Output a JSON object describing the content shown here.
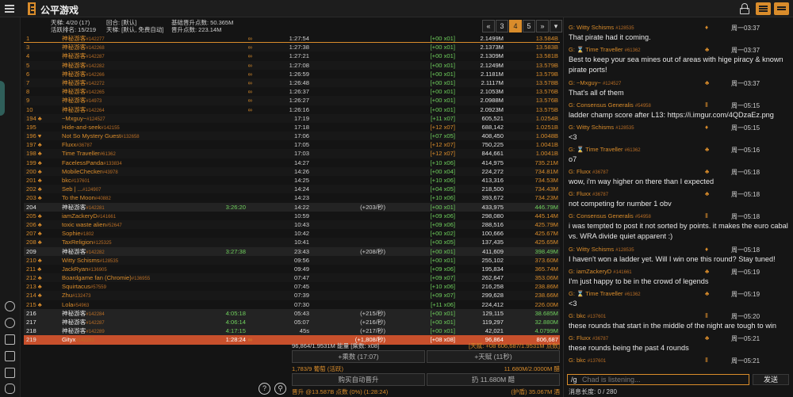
{
  "app": {
    "title": "公平游戏"
  },
  "stats": {
    "ladder": "天梯: 4/20 (17)",
    "active_rank": "活跃排名: 15/219",
    "round": "回合: [默认]",
    "ladder_type": "天梯: [默认, 免费自动]",
    "base_promote": "基础晋升点数: 50.365M",
    "promote_pts": "晋升点数: 223.14M"
  },
  "pager": {
    "first": "«",
    "pages": [
      "3",
      "4",
      "5"
    ],
    "active": "4",
    "last": "»",
    "dropdown": "▾"
  },
  "leaderboard": [
    {
      "rank": "1",
      "name": "神秘游客",
      "id": "#142277",
      "ex": "",
      "inf": "∞",
      "time": "1:27:54",
      "gain": "",
      "mult": "[+00 x01]",
      "pts": "2.1499M",
      "rate": "13.584B",
      "first": true
    },
    {
      "rank": "3",
      "name": "神秘游客",
      "id": "#142268",
      "ex": "",
      "inf": "∞",
      "time": "1:27:38",
      "gain": "",
      "mult": "[+00 x01]",
      "pts": "2.1373M",
      "rate": "13.583B"
    },
    {
      "rank": "4",
      "name": "神秘游客",
      "id": "#142287",
      "ex": "",
      "inf": "∞",
      "time": "1:27:21",
      "gain": "",
      "mult": "[+00 x01]",
      "pts": "2.1309M",
      "rate": "13.581B"
    },
    {
      "rank": "5",
      "name": "神秘游客",
      "id": "#142282",
      "ex": "",
      "inf": "∞",
      "time": "1:27:08",
      "gain": "",
      "mult": "[+00 x01]",
      "pts": "2.1249M",
      "rate": "13.579B"
    },
    {
      "rank": "6",
      "name": "神秘游客",
      "id": "#142266",
      "ex": "",
      "inf": "∞",
      "time": "1:26:59",
      "gain": "",
      "mult": "[+00 x01]",
      "pts": "2.1181M",
      "rate": "13.579B"
    },
    {
      "rank": "7",
      "name": "神秘游客",
      "id": "#142272",
      "ex": "",
      "inf": "∞",
      "time": "1:26:48",
      "gain": "",
      "mult": "[+00 x01]",
      "pts": "2.1117M",
      "rate": "13.578B"
    },
    {
      "rank": "8",
      "name": "神秘游客",
      "id": "#142265",
      "ex": "",
      "inf": "∞",
      "time": "1:26:37",
      "gain": "",
      "mult": "[+00 x01]",
      "pts": "2.1053M",
      "rate": "13.576B"
    },
    {
      "rank": "9",
      "name": "神秘游客",
      "id": "#14973",
      "ex": "",
      "inf": "∞",
      "time": "1:26:27",
      "gain": "",
      "mult": "[+00 x01]",
      "pts": "2.0988M",
      "rate": "13.576B"
    },
    {
      "rank": "10",
      "name": "神秘游客",
      "id": "#142264",
      "ex": "",
      "inf": "∞",
      "time": "1:26:16",
      "gain": "",
      "mult": "[+00 x01]",
      "pts": "2.0923M",
      "rate": "13.575B"
    },
    {
      "rank": "194 ♣",
      "name": "~Mxguy~",
      "id": "#124527",
      "ex": "",
      "inf": "",
      "time": "17:19",
      "gain": "",
      "mult": "[+11 x07]",
      "pts": "605,521",
      "rate": "1.0254B"
    },
    {
      "rank": "195",
      "name": "Hide-and-seek",
      "id": "#142155",
      "ex": "",
      "inf": "",
      "time": "17:18",
      "gain": "",
      "mult": "[+12 x07]",
      "pts": "688,142",
      "rate": "1.0251B",
      "warn": true
    },
    {
      "rank": "196 ♥",
      "name": "Not So Mystery Guest",
      "id": "#132658",
      "ex": "",
      "inf": "",
      "time": "17:06",
      "gain": "",
      "mult": "[+07 x05]",
      "pts": "408,450",
      "rate": "1.0048B"
    },
    {
      "rank": "197 ♣",
      "name": "Fluxx",
      "id": "#36787",
      "ex": "",
      "inf": "",
      "time": "17:05",
      "gain": "",
      "mult": "[+12 x07]",
      "pts": "750,225",
      "rate": "1.0041B",
      "warn": true
    },
    {
      "rank": "198 ♣",
      "name": "Time Traveller",
      "id": "#61362",
      "ex": "",
      "inf": "",
      "time": "17:03",
      "gain": "",
      "mult": "[+12 x07]",
      "pts": "844,661",
      "rate": "1.0041B",
      "warn": true
    },
    {
      "rank": "199 ♣",
      "name": "FacelessPanda",
      "id": "#133834",
      "ex": "",
      "inf": "",
      "time": "14:27",
      "gain": "",
      "mult": "[+10 x06]",
      "pts": "414,975",
      "rate": "735.21M"
    },
    {
      "rank": "200 ♣",
      "name": "MobileChecker",
      "id": "#43978",
      "ex": "",
      "inf": "",
      "time": "14:26",
      "gain": "",
      "mult": "[+00 x04]",
      "pts": "224,272",
      "rate": "734.81M"
    },
    {
      "rank": "201 ♣",
      "name": "bkc",
      "id": "#137601",
      "ex": "",
      "inf": "",
      "time": "14:25",
      "gain": "",
      "mult": "[+10 x06]",
      "pts": "413,316",
      "rate": "734.53M"
    },
    {
      "rank": "202 ♣",
      "name": "Seb | ...",
      "id": "#124907",
      "ex": "",
      "inf": "",
      "time": "14:24",
      "gain": "",
      "mult": "[+04 x05]",
      "pts": "218,500",
      "rate": "734.43M"
    },
    {
      "rank": "203 ♣",
      "name": "To the Moon",
      "id": "#40882",
      "ex": "",
      "inf": "",
      "time": "14:23",
      "gain": "",
      "mult": "[+10 x06]",
      "pts": "393,672",
      "rate": "734.23M"
    },
    {
      "rank": "204",
      "name": "神秘游客",
      "id": "#142281",
      "ex": "3:26:20",
      "inf": "",
      "time": "14:22",
      "gain": "(+203/秒)",
      "mult": "[+00 x01]",
      "pts": "433,975",
      "rate": "446.79M",
      "self": true
    },
    {
      "rank": "205 ♣",
      "name": "iamZackeryD",
      "id": "#141661",
      "ex": "",
      "inf": "",
      "time": "10:59",
      "gain": "",
      "mult": "[+09 x06]",
      "pts": "298,080",
      "rate": "445.14M"
    },
    {
      "rank": "206 ♣",
      "name": "toxic waste alien",
      "id": "#52647",
      "ex": "",
      "inf": "",
      "time": "10:43",
      "gain": "",
      "mult": "[+09 x06]",
      "pts": "288,516",
      "rate": "425.79M"
    },
    {
      "rank": "207 ♣",
      "name": "Sophie",
      "id": "#1802",
      "ex": "",
      "inf": "",
      "time": "10:42",
      "gain": "",
      "mult": "[+00 x02]",
      "pts": "100,666",
      "rate": "425.67M"
    },
    {
      "rank": "208 ♣",
      "name": "TaxReligion",
      "id": "#125325",
      "ex": "",
      "inf": "",
      "time": "10:41",
      "gain": "",
      "mult": "[+00 x05]",
      "pts": "137,435",
      "rate": "425.65M"
    },
    {
      "rank": "209",
      "name": "神秘游客",
      "id": "#142282",
      "ex": "3:27:38",
      "inf": "",
      "time": "23:43",
      "gain": "(+208/秒)",
      "mult": "[+00 x01]",
      "pts": "411,609",
      "rate": "398.49M",
      "self": true
    },
    {
      "rank": "210 ♣",
      "name": "Witty Schisms",
      "id": "#128535",
      "ex": "",
      "inf": "",
      "time": "09:56",
      "gain": "",
      "mult": "[+00 x01]",
      "pts": "255,102",
      "rate": "373.60M"
    },
    {
      "rank": "211 ♣",
      "name": "JackRyan",
      "id": "#136905",
      "ex": "",
      "inf": "",
      "time": "09:49",
      "gain": "",
      "mult": "[+09 x06]",
      "pts": "195,834",
      "rate": "365.74M"
    },
    {
      "rank": "212 ♣",
      "name": "Boardgame fan (Chromie)",
      "id": "#136955",
      "ex": "",
      "inf": "",
      "time": "07:47",
      "gain": "",
      "mult": "[+09 x07]",
      "pts": "262,647",
      "rate": "353.06M"
    },
    {
      "rank": "213 ♣",
      "name": "Squirtacus",
      "id": "#57559",
      "ex": "",
      "inf": "",
      "time": "07:45",
      "gain": "",
      "mult": "[+10 x06]",
      "pts": "216,258",
      "rate": "238.86M"
    },
    {
      "rank": "214 ♣",
      "name": "Zhu",
      "id": "#132473",
      "ex": "",
      "inf": "",
      "time": "07:39",
      "gain": "",
      "mult": "[+09 x07]",
      "pts": "299,628",
      "rate": "238.66M"
    },
    {
      "rank": "215 ♣",
      "name": "Lola",
      "id": "#54963",
      "ex": "",
      "inf": "",
      "time": "07:30",
      "gain": "",
      "mult": "[+11 x06]",
      "pts": "224,412",
      "rate": "226.00M"
    },
    {
      "rank": "216",
      "name": "神秘游客",
      "id": "#142284",
      "ex": "4:05:18",
      "inf": "",
      "time": "05:43",
      "gain": "(+215/秒)",
      "mult": "[+00 x01]",
      "pts": "129,115",
      "rate": "38.685M",
      "self": true
    },
    {
      "rank": "217",
      "name": "神秘游客",
      "id": "#142287",
      "ex": "4:06:14",
      "inf": "",
      "time": "05:07",
      "gain": "(+216/秒)",
      "mult": "[+00 x01]",
      "pts": "119,297",
      "rate": "32.880M",
      "self": true
    },
    {
      "rank": "218",
      "name": "神秘游客",
      "id": "#142289",
      "ex": "4:17:15",
      "inf": "",
      "time": "45s",
      "gain": "(+217/秒)",
      "mult": "[+00 x01]",
      "pts": "42,021",
      "rate": "4.0799M",
      "self": true
    },
    {
      "rank": "219",
      "name": "Gityx",
      "id": "#142283",
      "ex": "1:28:24",
      "inf": "∞",
      "time": "",
      "gain": "(+1,808/秒)",
      "mult": "[+08 x08]",
      "pts": "96,864",
      "rate": "806,687",
      "me": true
    }
  ],
  "panel": {
    "power": "96,864/1.9531M 能量 [乘数: x08]",
    "heaven": "[天赋: +08 606,687/1.9531M 点数]",
    "multiplier_btn": "+乘数 (17:07)",
    "heaven_btn": "+天赋 (11秒)",
    "grapes": "1,783/9 葡萄 (活跃)",
    "grapes_right": "11.680M/2.0000M 醋",
    "auto_btn": "购买自动晋升",
    "throw_btn": "扔 11.680M 醋",
    "footer_left": "晋升 @13.587B 点数 (0%) (1:28:24)",
    "footer_right": "(护盾) 35.067M 酒"
  },
  "chat": {
    "messages": [
      {
        "user": "G: Witty Schisms",
        "id": "#128535",
        "badge": "♦",
        "time": "周一03:37",
        "text": "That pirate had it coming."
      },
      {
        "user": "G: ⌛ Time Traveller",
        "id": "#61362",
        "badge": "♣",
        "time": "周一03:37",
        "text": "Best to keep your sea mines out of areas with hige piracy & known pirate ports!"
      },
      {
        "user": "G: ~Mxguy~",
        "id": "#124527",
        "badge": "♣",
        "time": "周一03:37",
        "text": "That's all of them"
      },
      {
        "user": "G: Consensus Generalis",
        "id": "#54958",
        "badge": "Ⅱ",
        "time": "周一05:15",
        "text": "ladder champ score after L13: https://i.imgur.com/4QDzaEz.png"
      },
      {
        "user": "G: Witty Schisms",
        "id": "#128535",
        "badge": "♦",
        "time": "周一05:15",
        "text": "<3"
      },
      {
        "user": "G: ⌛ Time Traveller",
        "id": "#61362",
        "badge": "♣",
        "time": "周一05:16",
        "text": "o7"
      },
      {
        "user": "G: Fluxx",
        "id": "#36787",
        "badge": "♣",
        "time": "周一05:18",
        "text": "wow, i'm way higher on there than I expected"
      },
      {
        "user": "G: Fluxx",
        "id": "#36787",
        "badge": "♣",
        "time": "周一05:18",
        "text": "not competing for number 1 obv"
      },
      {
        "user": "G: Consensus Generalis",
        "id": "#54958",
        "badge": "Ⅱ",
        "time": "周一05:18",
        "text": "i was tempted to post it not sorted by points. it makes the euro cabal vs. WRA divide quiet apparent :)"
      },
      {
        "user": "G: Witty Schisms",
        "id": "#128535",
        "badge": "♦",
        "time": "周一05:18",
        "text": "I haven't won a ladder yet. Will I win one this round? Stay tuned!"
      },
      {
        "user": "G: iamZackeryD",
        "id": "#141661",
        "badge": "♣",
        "time": "周一05:19",
        "text": "I'm just happy to be in the crowd of legends"
      },
      {
        "user": "G: ⌛ Time Traveller",
        "id": "#61362",
        "badge": "♣",
        "time": "周一05:19",
        "text": "<3"
      },
      {
        "user": "G: bkc",
        "id": "#137601",
        "badge": "Ⅱ",
        "time": "周一05:20",
        "text": "these rounds that start in the middle of the night are tough to win"
      },
      {
        "user": "G: Fluxx",
        "id": "#36787",
        "badge": "♣",
        "time": "周一05:21",
        "text": "these rounds being the past 4 rounds"
      },
      {
        "user": "G: bkc",
        "id": "#137601",
        "badge": "Ⅱ",
        "time": "周一05:21",
        "text": ""
      }
    ],
    "input_prefix": "/g",
    "placeholder": "Chad is listening...",
    "send": "发送",
    "char_count": "消息长度: 0 / 280"
  }
}
